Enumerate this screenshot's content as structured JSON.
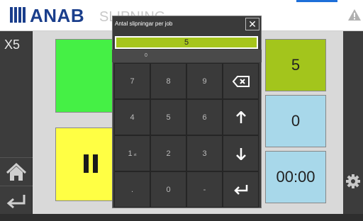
{
  "header": {
    "logo_text": "ANAB",
    "title": "SLIPNING"
  },
  "sidebar": {
    "top_label": "X5"
  },
  "tiles": {
    "count_value": "5",
    "done_value": "0",
    "time_value": "00:00"
  },
  "dialog": {
    "title": "Antal slipningar per job",
    "input_value": "5",
    "sub_value": "0",
    "close_label": "✕",
    "keys": [
      "7",
      "8",
      "9",
      "4",
      "5",
      "6",
      "1",
      "2",
      "3",
      ".",
      "0",
      "-"
    ],
    "key_1_suffix": "st"
  },
  "colors": {
    "brand_blue": "#1a3e8c",
    "accent_blue": "#1e6fd9",
    "tile_green": "#45f045",
    "tile_yellow": "#ffff44",
    "tile_olive": "#a3c51c",
    "tile_blue": "#a8d8ea"
  },
  "icons": [
    "warning-icon",
    "home-icon",
    "return-icon",
    "gear-icon",
    "pause-icon",
    "backspace-icon",
    "arrow-up-icon",
    "arrow-down-icon",
    "enter-icon",
    "close-icon"
  ]
}
